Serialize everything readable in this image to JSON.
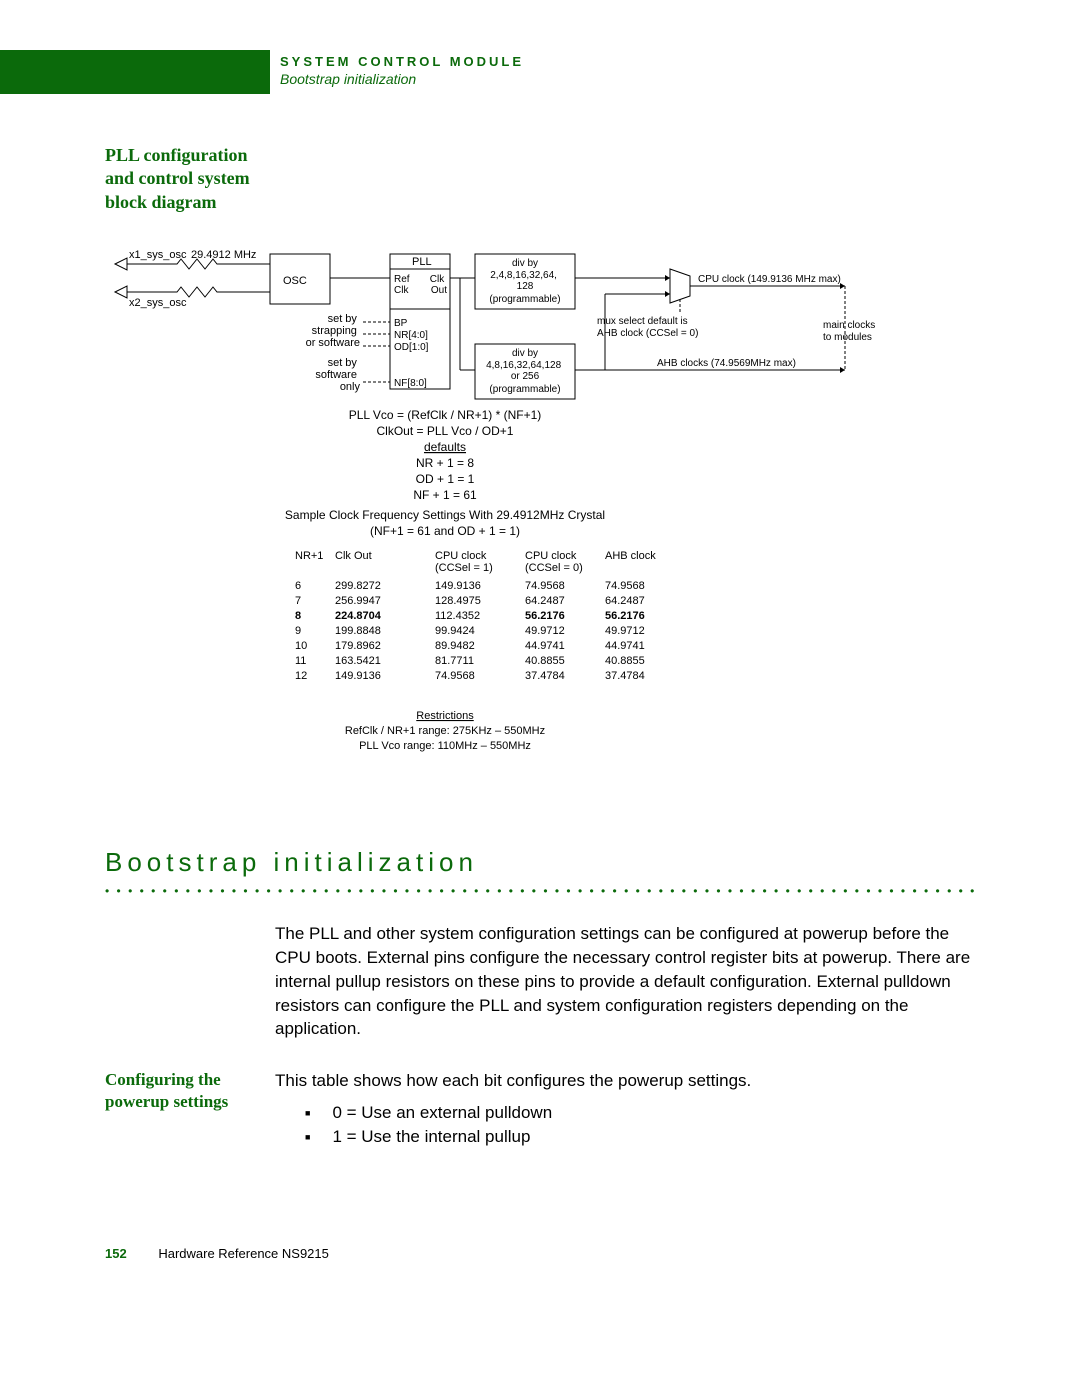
{
  "header": {
    "title": "SYSTEM CONTROL MODULE",
    "subtitle": "Bootstrap initialization"
  },
  "side_heading_1": "PLL configuration and control system block diagram",
  "diagram": {
    "x1_sys_osc": "x1_sys_osc",
    "x2_sys_osc": "x2_sys_osc",
    "freq": "29.4912 MHz",
    "osc": "OSC",
    "set_by_strapping": "set by\nstrapping\nor software",
    "set_by_software": "set by\nsoftware\nonly",
    "pll": "PLL",
    "refclk": "Ref\nClk",
    "clkout": "Clk\nOut",
    "bp": "BP",
    "nr": "NR[4:0]",
    "od": "OD[1:0]",
    "nf": "NF[8:0]",
    "div1_title": "div by",
    "div1_vals": "2,4,8,16,32,64,\n128",
    "div1_prog": "(programmable)",
    "div2_title": "div by",
    "div2_vals": "4,8,16,32,64,128\nor 256",
    "div2_prog": "(programmable)",
    "cpu_clock": "CPU clock (149.9136 MHz max)",
    "mux_default": "mux select default is\nAHB clock (CCSel = 0)",
    "ahb_clocks": "AHB clocks (74.9569MHz max)",
    "main_clocks": "main clocks\nto modules",
    "formula1": "PLL Vco = (RefClk / NR+1) * (NF+1)",
    "formula2": "ClkOut = PLL Vco / OD+1",
    "defaults_label": "defaults",
    "nr_default": "NR + 1 = 8",
    "od_default": "OD + 1 = 1",
    "nf_default": "NF + 1 = 61",
    "sample_title": "Sample Clock Frequency Settings With 29.4912MHz Crystal",
    "sample_sub": "(NF+1 = 61 and OD + 1 = 1)",
    "table_headers": [
      "NR+1",
      "Clk Out",
      "CPU clock\n(CCSel = 1)",
      "CPU clock\n(CCSel = 0)",
      "AHB clock"
    ],
    "table_rows": [
      [
        "6",
        "299.8272",
        "149.9136",
        "74.9568",
        "74.9568"
      ],
      [
        "7",
        "256.9947",
        "128.4975",
        "64.2487",
        "64.2487"
      ],
      [
        "8",
        "224.8704",
        "112.4352",
        "56.2176",
        "56.2176"
      ],
      [
        "9",
        "199.8848",
        "99.9424",
        "49.9712",
        "49.9712"
      ],
      [
        "10",
        "179.8962",
        "89.9482",
        "44.9741",
        "44.9741"
      ],
      [
        "11",
        "163.5421",
        "81.7711",
        "40.8855",
        "40.8855"
      ],
      [
        "12",
        "149.9136",
        "74.9568",
        "37.4784",
        "37.4784"
      ]
    ],
    "bold_row_index": 2,
    "restrictions_label": "Restrictions",
    "restriction1": "RefClk / NR+1 range: 275KHz – 550MHz",
    "restriction2": "PLL Vco range: 110MHz – 550MHz"
  },
  "section_title": "Bootstrap initialization",
  "bootstrap_para": "The PLL and other system configuration settings can be configured at powerup before the CPU boots. External pins configure the necessary control register bits at powerup. There are internal pullup resistors on these pins to provide a default configuration. External pulldown resistors can configure the PLL and system configuration registers depending on the application.",
  "side_heading_2": "Configuring the powerup settings",
  "config_intro": "This table shows how each bit configures the powerup settings.",
  "bullet1": "0 = Use an external pulldown",
  "bullet2": "1 = Use the internal pullup",
  "footer": {
    "page": "152",
    "ref": "Hardware Reference NS9215"
  }
}
